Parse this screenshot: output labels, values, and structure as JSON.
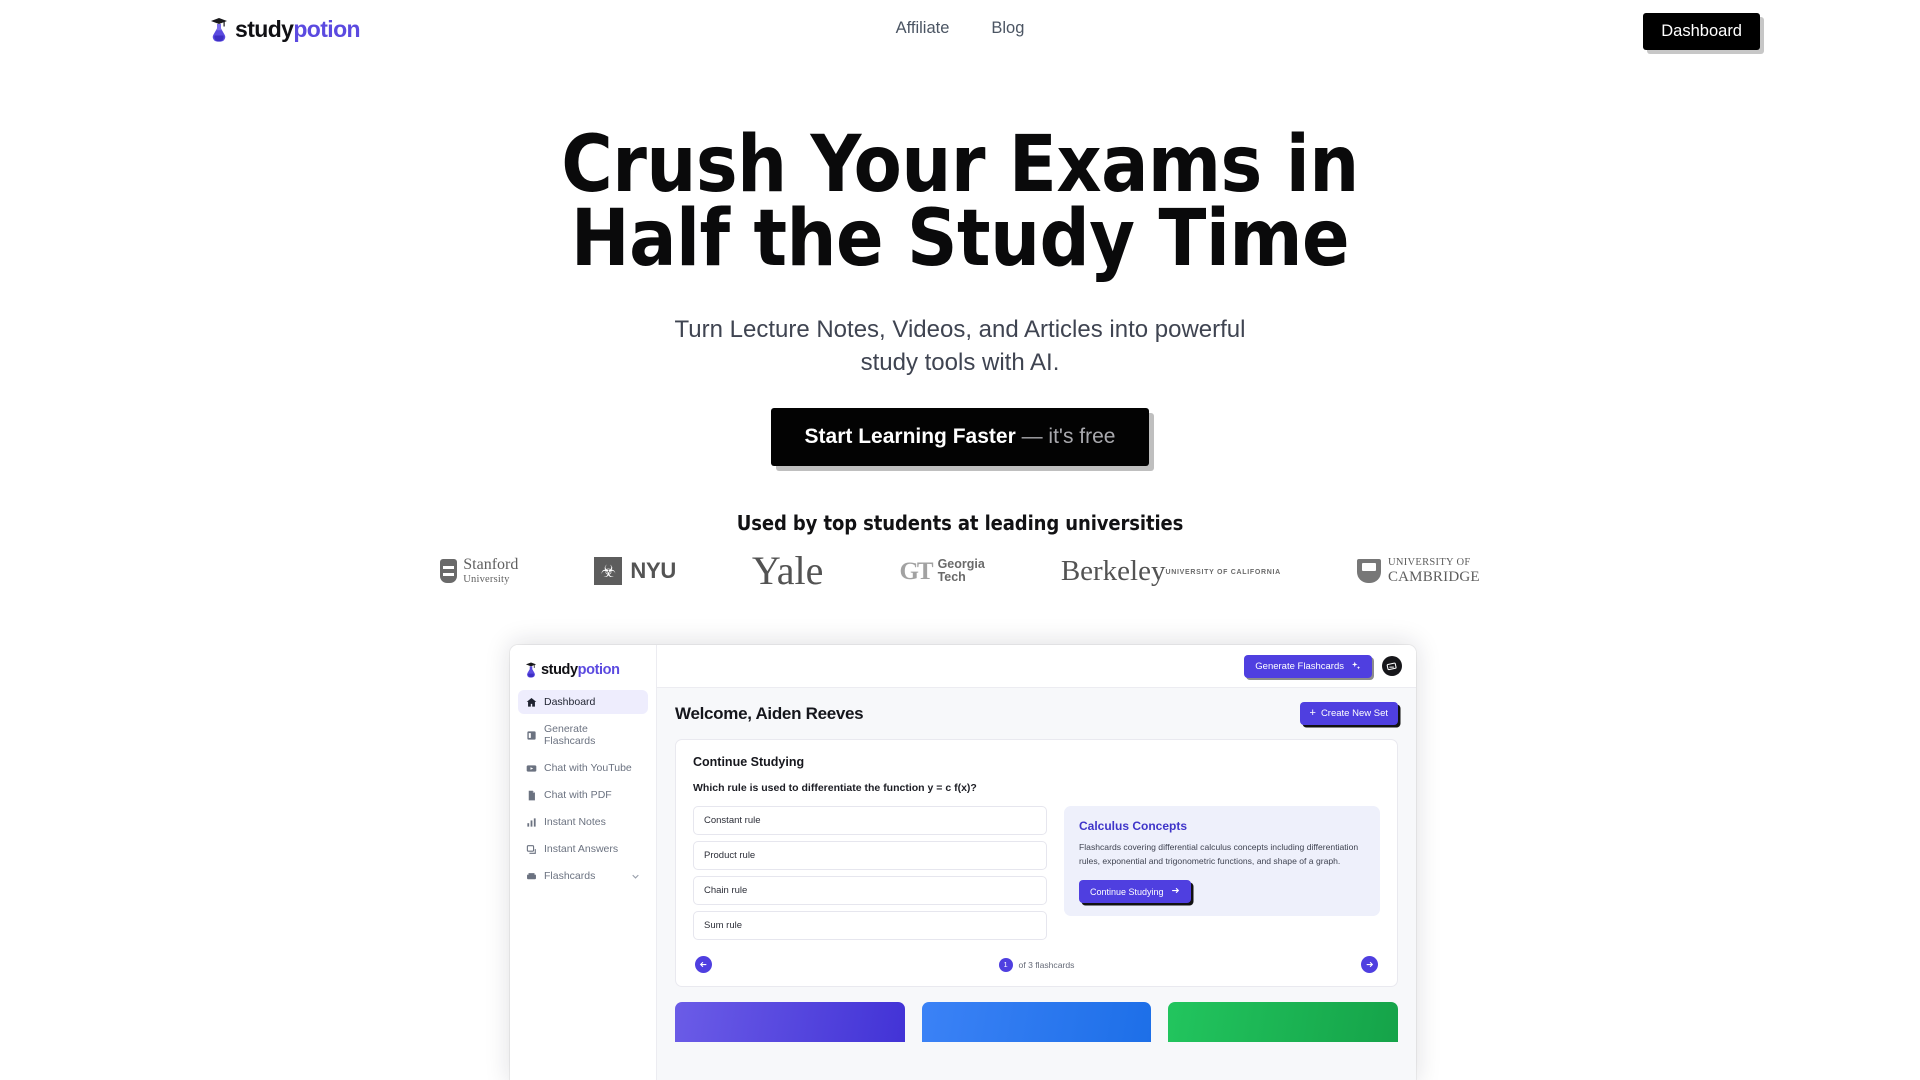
{
  "brand": {
    "name_part1": "study",
    "name_part2": "potion",
    "icon": "potion-flask-graduation-icon"
  },
  "nav": {
    "links": [
      {
        "label": "Affiliate",
        "name": "nav-link-affiliate"
      },
      {
        "label": "Blog",
        "name": "nav-link-blog"
      }
    ],
    "dashboard_label": "Dashboard"
  },
  "hero": {
    "title_line1": "Crush Your Exams in",
    "title_line2": "Half the Study Time",
    "subtitle_line1": "Turn Lecture Notes, Videos, and Articles into powerful",
    "subtitle_line2": "study tools with AI.",
    "cta_main": "Start Learning Faster",
    "cta_sub": " — it's free"
  },
  "social_proof": {
    "heading": "Used by top students at leading universities",
    "logos": [
      {
        "name": "stanford-logo",
        "primary": "Stanford",
        "secondary": "University"
      },
      {
        "name": "nyu-logo",
        "primary": "NYU",
        "secondary": ""
      },
      {
        "name": "yale-logo",
        "primary": "Yale",
        "secondary": ""
      },
      {
        "name": "georgia-tech-logo",
        "primary": "Georgia",
        "secondary": "Tech"
      },
      {
        "name": "berkeley-logo",
        "primary": "Berkeley",
        "secondary": "UNIVERSITY OF CALIFORNIA"
      },
      {
        "name": "cambridge-logo",
        "primary": "CAMBRIDGE",
        "secondary": "UNIVERSITY OF"
      }
    ]
  },
  "app_preview": {
    "brand": {
      "name_part1": "study",
      "name_part2": "potion"
    },
    "sidebar": {
      "items": [
        {
          "label": "Dashboard",
          "icon": "home-icon",
          "active": true
        },
        {
          "label": "Generate Flashcards",
          "icon": "cards-icon",
          "active": false
        },
        {
          "label": "Chat with YouTube",
          "icon": "video-icon",
          "active": false
        },
        {
          "label": "Chat with PDF",
          "icon": "pdf-file-icon",
          "active": false
        },
        {
          "label": "Instant Notes",
          "icon": "notes-icon",
          "active": false
        },
        {
          "label": "Instant Answers",
          "icon": "answers-icon",
          "active": false
        },
        {
          "label": "Flashcards",
          "icon": "flashcards-icon",
          "active": false,
          "expandable": true
        }
      ]
    },
    "topbar": {
      "generate_label": "Generate Flashcards",
      "generate_icon": "sparkles-icon",
      "avatar_icon": "flashcard-stack-icon"
    },
    "welcome_title": "Welcome, Aiden Reeves",
    "create_set_label": "Create New Set",
    "create_set_icon": "plus-icon",
    "study_card": {
      "title": "Continue Studying",
      "question": "Which rule is used to differentiate the function y = c f(x)?",
      "options": [
        "Constant rule",
        "Product rule",
        "Chain rule",
        "Sum rule"
      ],
      "concept": {
        "title": "Calculus Concepts",
        "description": "Flashcards covering differential calculus concepts including differentiation rules, exponential and trigonometric functions, and shape of a graph.",
        "button_label": "Continue Studying",
        "button_icon": "arrow-right-icon"
      },
      "pager": {
        "prev_icon": "arrow-left-icon",
        "next_icon": "arrow-right-icon",
        "current": "1",
        "label": "of 3 flashcards"
      }
    },
    "bottom_cards": [
      {
        "name": "bottom-card-purple",
        "color": "#4f3fe0"
      },
      {
        "name": "bottom-card-blue",
        "color": "#2b7ef0"
      },
      {
        "name": "bottom-card-green",
        "color": "#1cb85c"
      }
    ]
  },
  "colors": {
    "accent": "#4f3fe0",
    "brand_purple": "#5b4ae0",
    "dark": "#000000"
  }
}
